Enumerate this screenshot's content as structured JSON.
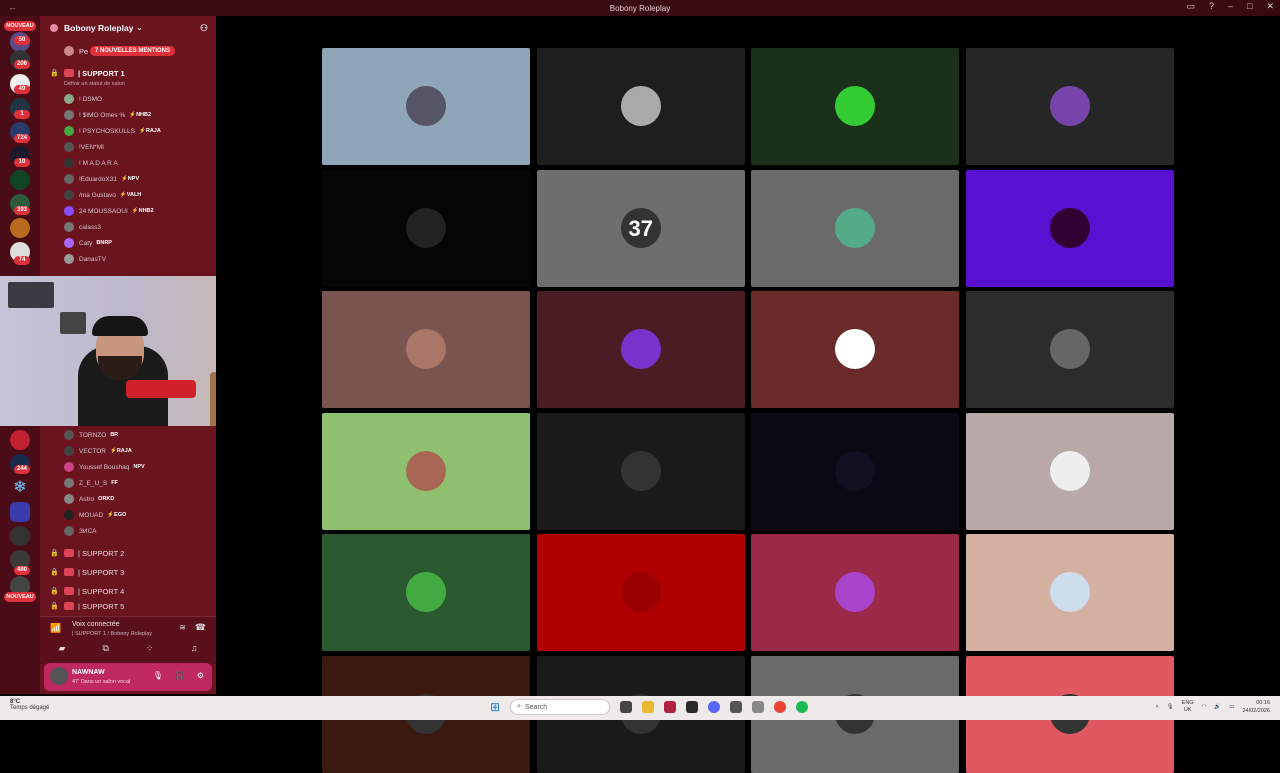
{
  "window": {
    "title": "Bobony Roleplay"
  },
  "rail": {
    "nouveau_label": "NOUVEAU",
    "badges": [
      "50",
      "206",
      "49",
      "1",
      "724",
      "10",
      "393",
      "74",
      "244",
      "480"
    ]
  },
  "sidebar": {
    "server_name": "Bobony Roleplay",
    "mentions_label": "7 NOUVELLES MENTIONS",
    "top_channel": "Pe",
    "active_channel": "| SUPPORT 1",
    "channel_status": "Définir un statut de salon",
    "members_top": [
      {
        "name": "! DSMO",
        "tag": "",
        "color": "#8a8"
      },
      {
        "name": "! $IMO Omes %",
        "tag": "⚡NHB2",
        "color": "#777"
      },
      {
        "name": "! PSYCHOSKULLS",
        "tag": "⚡RAJA",
        "color": "#4a4"
      },
      {
        "name": "!VEN*MI",
        "tag": "",
        "color": "#555"
      },
      {
        "name": "! M A D A R A",
        "tag": "",
        "color": "#333"
      },
      {
        "name": "!EduardoX31",
        "tag": "⚡NPV",
        "color": "#666"
      },
      {
        "name": "/ma Gustavo",
        "tag": "⚡VALH",
        "color": "#444"
      },
      {
        "name": "24 MOUSSAOUI",
        "tag": "⚡NHB2",
        "color": "#8a4cff"
      },
      {
        "name": "calass3",
        "tag": "",
        "color": "#777"
      },
      {
        "name": "Caty",
        "tag": "BNRP",
        "color": "#a6f"
      },
      {
        "name": "DanasTV",
        "tag": "",
        "color": "#999"
      }
    ],
    "members_bottom": [
      {
        "name": "TORNZO",
        "tag": "BR",
        "color": "#555"
      },
      {
        "name": "VECTOR",
        "tag": "⚡RAJA",
        "color": "#444"
      },
      {
        "name": "Youssef Boushaq",
        "tag": "NPV",
        "color": "#c48"
      },
      {
        "name": "Z_E_U_S",
        "tag": "FF",
        "color": "#777"
      },
      {
        "name": "Astro",
        "tag": "ORKD",
        "color": "#888"
      },
      {
        "name": "MOUAD",
        "tag": "⚡EGO",
        "color": "#222"
      },
      {
        "name": "ЗИСА",
        "tag": "",
        "color": "#666"
      }
    ],
    "support_channels": [
      "| SUPPORT 2",
      "| SUPPORT 3",
      "| SUPPORT 4",
      "| SUPPORT 5"
    ],
    "voice_status": "Voix connectée",
    "voice_location": "| SUPPORT 1 / Bobony Roleplay",
    "user_name": "NAWNAW",
    "user_status": "47' Dans un salon vocal"
  },
  "grid": {
    "count_label": "37",
    "tiles": [
      {
        "bg": "#8ea6b8",
        "av": "#556"
      },
      {
        "bg": "#1e1e1e",
        "av": "#aaa"
      },
      {
        "bg": "#1a301a",
        "av": "#3c3"
      },
      {
        "bg": "#262626",
        "av": "#74a"
      },
      {
        "bg": "#050505",
        "av": "#222"
      },
      {
        "bg": "#6e6e6e",
        "av": "#333"
      },
      {
        "bg": "#6a6a6a",
        "av": "#5a8"
      },
      {
        "bg": "#5a10d0",
        "av": "#303"
      },
      {
        "bg": "#7a5550",
        "av": "#a76"
      },
      {
        "bg": "#4a1c24",
        "av": "#73c"
      },
      {
        "bg": "#6a2a2a",
        "av": "#fff"
      },
      {
        "bg": "#2c2c2c",
        "av": "#666"
      },
      {
        "bg": "#8ec070",
        "av": "#a65"
      },
      {
        "bg": "#1a1a1a",
        "av": "#333"
      },
      {
        "bg": "#0a0a16",
        "av": "#101020"
      },
      {
        "bg": "#b8a8a8",
        "av": "#eee"
      },
      {
        "bg": "#2c5a30",
        "av": "#4a4"
      },
      {
        "bg": "#b00000",
        "av": "#900"
      },
      {
        "bg": "#9a2a48",
        "av": "#a4c"
      },
      {
        "bg": "#d4b0a0",
        "av": "#cde"
      },
      {
        "bg": "#3a1a10",
        "av": "#333"
      },
      {
        "bg": "#1a1a1a",
        "av": "#333"
      },
      {
        "bg": "#6a6a6a",
        "av": "#333"
      },
      {
        "bg": "#e05860",
        "av": "#333"
      }
    ]
  },
  "taskbar": {
    "weather_temp": "8°C",
    "weather_desc": "Temps dégagé",
    "search_placeholder": "Search",
    "lang": "ENG",
    "region": "UK",
    "time": "00:16",
    "date": "24/02/2026"
  }
}
